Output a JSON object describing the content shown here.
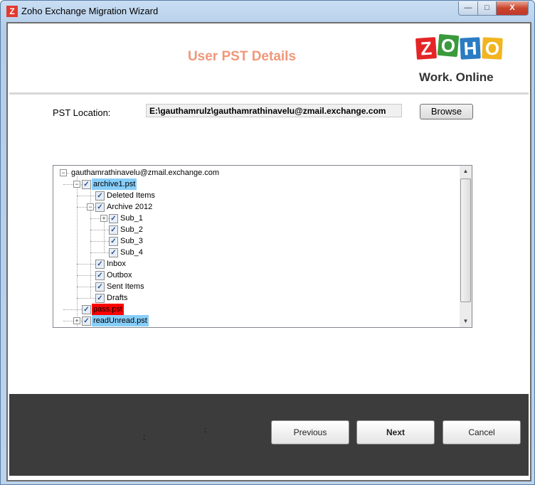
{
  "window": {
    "title": "Zoho Exchange Migration Wizard",
    "app_icon": "Z",
    "minimize": "—",
    "maximize": "□",
    "close": "X"
  },
  "header": {
    "title": "User PST Details",
    "logo_letters": [
      "Z",
      "O",
      "H",
      "O"
    ],
    "logo_tagline": "Work. Online"
  },
  "pst": {
    "label": "PST Location:",
    "value": "E:\\gauthamrulz\\gauthamrathinavelu@zmail.exchange.com",
    "browse_label": "Browse"
  },
  "tree": {
    "items": [
      {
        "label": "gauthamrathinavelu@zmail.exchange.com",
        "level": 0,
        "expander": "minus",
        "checkbox": false
      },
      {
        "label": "archive1.pst",
        "level": 1,
        "expander": "minus",
        "checkbox": true,
        "highlight": "#87cefa"
      },
      {
        "label": "Deleted Items",
        "level": 2,
        "checkbox": true
      },
      {
        "label": "Archive 2012",
        "level": 2,
        "expander": "minus",
        "checkbox": true
      },
      {
        "label": "Sub_1",
        "level": 3,
        "expander": "plus",
        "checkbox": true
      },
      {
        "label": "Sub_2",
        "level": 3,
        "checkbox": true
      },
      {
        "label": "Sub_3",
        "level": 3,
        "checkbox": true
      },
      {
        "label": "Sub_4",
        "level": 3,
        "checkbox": true
      },
      {
        "label": "Inbox",
        "level": 2,
        "checkbox": true
      },
      {
        "label": "Outbox",
        "level": 2,
        "checkbox": true
      },
      {
        "label": "Sent Items",
        "level": 2,
        "checkbox": true
      },
      {
        "label": "Drafts",
        "level": 2,
        "checkbox": true
      },
      {
        "label": "pass.pst",
        "level": 1,
        "checkbox": true,
        "highlight": "#ff0000"
      },
      {
        "label": "readUnread.pst",
        "level": 1,
        "expander": "plus",
        "checkbox": true,
        "highlight": "#87cefa"
      }
    ]
  },
  "footer": {
    "colon1": ":",
    "colon2": ":",
    "previous": "Previous",
    "next": "Next",
    "cancel": "Cancel"
  }
}
